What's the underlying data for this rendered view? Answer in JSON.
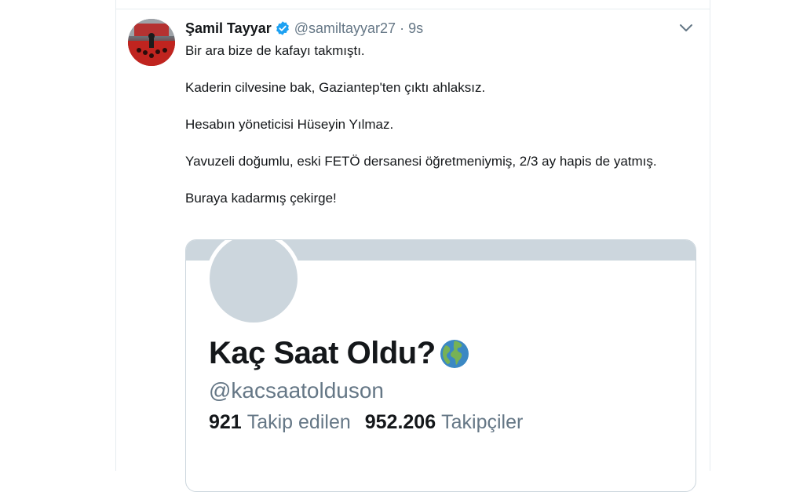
{
  "tweet": {
    "author_name": "Şamil Tayyar",
    "handle": "@samiltayyar27",
    "separator": "·",
    "time": "9s",
    "icons": {
      "verified": "verified-badge-icon",
      "more": "chevron-down-icon"
    },
    "paragraphs": [
      "Bir ara bize de kafayı takmıştı.",
      "Kaderin cilvesine bak, Gaziantep'ten çıktı ahlaksız.",
      "Hesabın yöneticisi Hüseyin Yılmaz.",
      "Yavuzeli doğumlu, eski FETÖ dersanesi öğretmeniymiş, 2/3 ay hapis de yatmış.",
      "Buraya kadarmış çekirge!"
    ]
  },
  "card": {
    "profile_name": "Kaç Saat Oldu?",
    "profile_emoji": "globe-icon",
    "profile_handle": "@kacsaatolduson",
    "following_count": "921",
    "following_label": "Takip edilen",
    "followers_count": "952.206",
    "followers_label": "Takipçiler"
  },
  "colors": {
    "verified_blue": "#1da1f2",
    "secondary_text": "#657786",
    "placeholder_gray": "#ccd6dd"
  }
}
